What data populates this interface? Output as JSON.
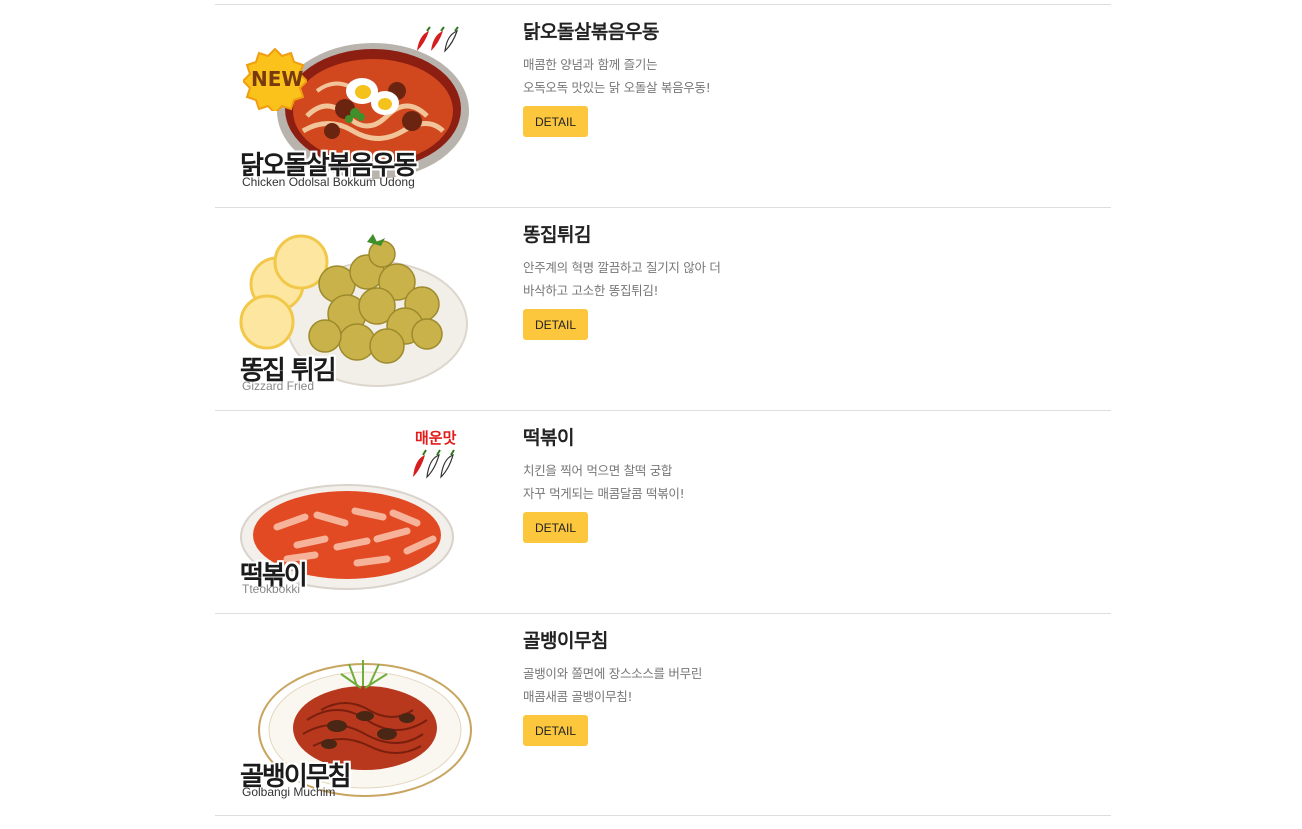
{
  "menu": {
    "items": [
      {
        "title": "닭오돌살볶음우동",
        "desc_line1": "매콤한 양념과 함께 즐기는",
        "desc_line2": "오독오독 맛있는 닭 오돌살 볶음우동!",
        "image_title": "닭오돌살볶음우동",
        "image_subtitle": "Chicken Odolsal Bokkum Udong",
        "badge": "NEW",
        "spicy_level": 2,
        "detail_label": "DETAIL"
      },
      {
        "title": "똥집튀김",
        "desc_line1": "안주계의 혁명 깔끔하고 질기지 않아 더",
        "desc_line2": "바삭하고 고소한 똥집튀김!",
        "image_title": "똥집 튀김",
        "image_subtitle": "Gizzard Fried",
        "detail_label": "DETAIL"
      },
      {
        "title": "떡볶이",
        "desc_line1": "치킨을 찍어 먹으면 찰떡 궁합",
        "desc_line2": "자꾸 먹게되는 매콤달콤 떡볶이!",
        "image_title": "떡볶이",
        "image_subtitle": "Tteokbokki",
        "spicy_label": "매운맛",
        "spicy_level": 1,
        "detail_label": "DETAIL"
      },
      {
        "title": "골뱅이무침",
        "desc_line1": "골뱅이와 쫄면에 장스소스를 버무린",
        "desc_line2": "매콤새콤 골뱅이무침!",
        "image_title": "골뱅이무침",
        "image_subtitle": "Golbangi Muchim",
        "detail_label": "DETAIL"
      }
    ]
  },
  "colors": {
    "button": "#fcc63d",
    "divider": "#dddddd",
    "title": "#222222",
    "desc": "#777777",
    "spicy_red": "#e21b1b"
  }
}
